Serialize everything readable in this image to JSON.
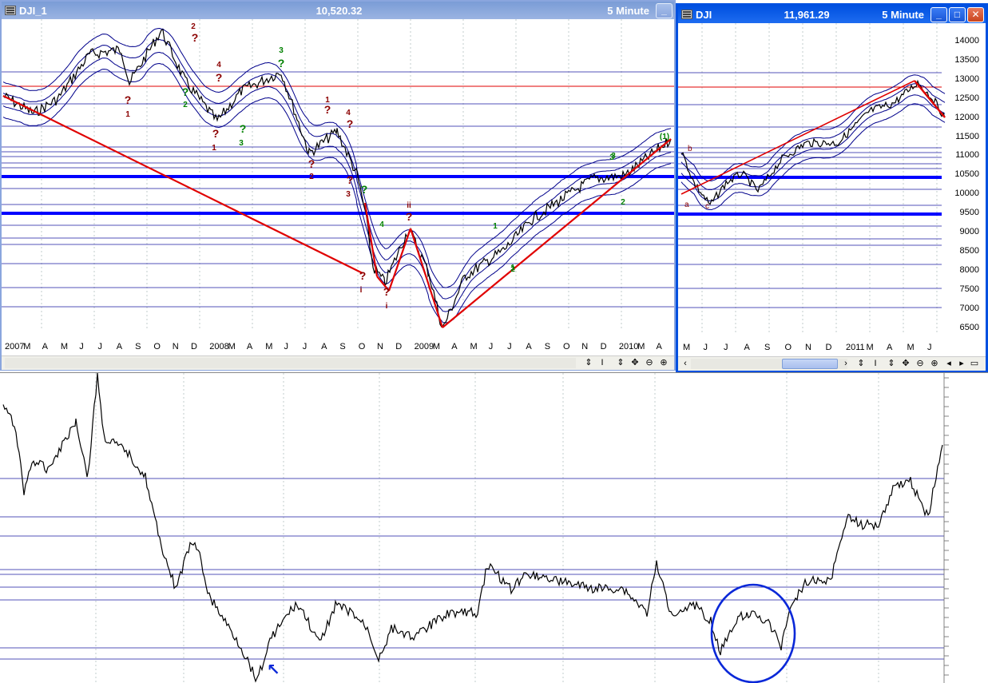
{
  "window_left": {
    "symbol": "DJI_1",
    "value": "10,520.32",
    "interval": "5 Minute",
    "min_glyph": "_",
    "x_axis_labels": [
      "2007",
      "M",
      "A",
      "M",
      "J",
      "J",
      "A",
      "S",
      "O",
      "N",
      "D",
      "2008",
      "M",
      "A",
      "M",
      "J",
      "J",
      "A",
      "S",
      "O",
      "N",
      "D",
      "2009",
      "M",
      "A",
      "M",
      "J",
      "J",
      "A",
      "S",
      "O",
      "N",
      "D",
      "2010",
      "M",
      "A"
    ],
    "wave_labels": [
      "?",
      "?",
      "?",
      "?",
      "?",
      "?",
      "?",
      "?",
      "?",
      "?",
      "?",
      "?",
      "?",
      "?",
      "?",
      "(1)",
      "i",
      "ii",
      "1",
      "2",
      "3",
      "4",
      "1",
      "2",
      "3",
      "1",
      "2",
      "3",
      "4",
      "1",
      "2",
      "3",
      "4",
      "i",
      "3",
      "1",
      "2"
    ]
  },
  "window_right": {
    "symbol": "DJI",
    "value": "11,961.29",
    "interval": "5 Minute",
    "min_glyph": "_",
    "max_glyph": "□",
    "close_glyph": "✕",
    "price_scale": [
      "14000",
      "13500",
      "13000",
      "12500",
      "12000",
      "11500",
      "11000",
      "10500",
      "10000",
      "9500",
      "9000",
      "8500",
      "8000",
      "7500",
      "7000",
      "6500"
    ],
    "x_axis_labels": [
      "M",
      "J",
      "J",
      "A",
      "S",
      "O",
      "N",
      "D",
      "2011",
      "M",
      "A",
      "M",
      "J"
    ],
    "wave_labels": [
      "a",
      "b",
      "c"
    ]
  },
  "scroll_controls": [
    "‹",
    "›",
    "⇕",
    "I",
    "⇕",
    "✥",
    "⊖",
    "⊕"
  ],
  "bottom_chart": {
    "annotation_arrow": "↖"
  },
  "colors": {
    "price_line": "#000000",
    "bands": "#00008b",
    "trendline": "#e00000",
    "support_line": "#0000ff",
    "title_active": "#0050e0",
    "title_inactive": "#8aa6de",
    "wave_red": "#8b0000",
    "wave_green": "#008000"
  }
}
